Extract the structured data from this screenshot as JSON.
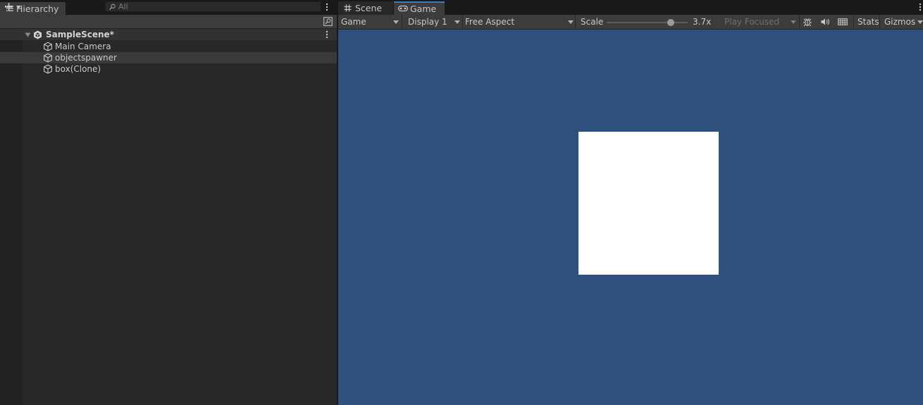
{
  "hierarchy": {
    "tab_label": "Hierarchy",
    "search_placeholder": "All",
    "scene": {
      "name": "SampleScene*"
    },
    "items": [
      {
        "label": "Main Camera"
      },
      {
        "label": "objectspawner",
        "selected": true
      },
      {
        "label": "box(Clone)"
      }
    ]
  },
  "game": {
    "tabs": [
      {
        "label": "Scene",
        "icon": "grid-hash-icon",
        "active": false
      },
      {
        "label": "Game",
        "icon": "gamepad-icon",
        "active": true
      }
    ],
    "toolbar": {
      "view_mode": "Game",
      "display": "Display 1",
      "aspect": "Free Aspect",
      "scale_label": "Scale",
      "scale_value": "3.7x",
      "play_mode": "Play Focused",
      "stats_label": "Stats",
      "gizmos_label": "Gizmos"
    },
    "viewport": {
      "background": "#2f4f7c",
      "box_color": "#ffffff"
    }
  },
  "colors": {
    "accent": "#3a79bb",
    "panel": "#282828",
    "toolbar": "#3c3c3c"
  }
}
